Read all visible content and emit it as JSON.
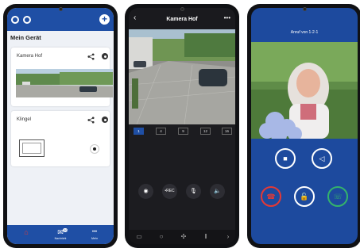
{
  "phone1": {
    "page_title": "Mein Gerät",
    "cards": [
      {
        "title": "Kamera Hof"
      },
      {
        "title": "Klingel"
      }
    ],
    "nav": [
      {
        "icon": "home-icon",
        "glyph": "⌂",
        "label": ""
      },
      {
        "icon": "mail-icon",
        "glyph": "✉",
        "label": "Nachricht",
        "badge": "20"
      },
      {
        "icon": "more-icon",
        "glyph": "•••",
        "label": "Mehr"
      }
    ],
    "colors": {
      "header": "#1f4fa5",
      "active": "#e53935"
    }
  },
  "phone2": {
    "title": "Kamera Hof",
    "back_glyph": "‹",
    "more_glyph": "•••",
    "tabs": [
      "1",
      "4",
      "9",
      "12",
      "16"
    ],
    "active_tab": "1",
    "controls": [
      {
        "icon": "camera-icon",
        "glyph": "◉"
      },
      {
        "icon": "record-icon",
        "glyph": "•REC"
      },
      {
        "icon": "microphone-icon",
        "glyph": "🎙"
      },
      {
        "icon": "speaker-icon",
        "glyph": "🔈"
      }
    ],
    "bottom": [
      {
        "icon": "grid-icon",
        "glyph": "▭"
      },
      {
        "icon": "search-icon",
        "glyph": "○"
      },
      {
        "icon": "ptz-icon",
        "glyph": "✣"
      },
      {
        "icon": "pause-icon",
        "glyph": "ǁ"
      },
      {
        "icon": "chevron-right-icon",
        "glyph": "›"
      }
    ]
  },
  "phone3": {
    "caller": "Anruf von 1-2-1",
    "buttons": [
      {
        "icon": "stop-icon",
        "glyph": "■"
      },
      {
        "icon": "speaker-mute-icon",
        "glyph": "◁"
      },
      {
        "icon": "hangup-icon",
        "glyph": "☎"
      },
      {
        "icon": "unlock-icon",
        "glyph": "🔓"
      },
      {
        "icon": "accept-call-icon",
        "glyph": "☏"
      }
    ],
    "colors": {
      "bg": "#1d4a9e",
      "hangup": "#e53935",
      "accept": "#34b36b"
    }
  }
}
